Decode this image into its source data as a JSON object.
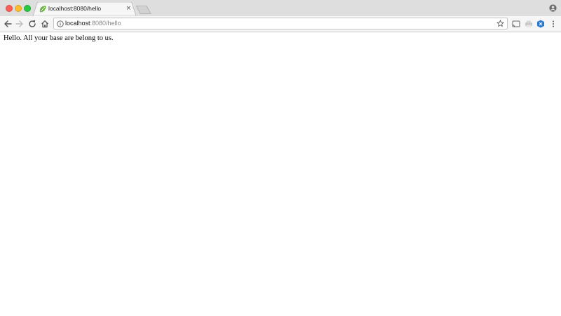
{
  "window": {
    "controls": [
      "close-button",
      "minimize-button",
      "zoom-button"
    ]
  },
  "tab": {
    "title": "localhost:8080/hello",
    "close_glyph": "×",
    "favicon": "spring-leaf-icon"
  },
  "address_bar": {
    "host": "localhost",
    "rest": ":8080/hello"
  },
  "page": {
    "text": "Hello. All your base are belong to us."
  },
  "colors": {
    "chrome_bg": "#dedede",
    "toolbar_bg": "#f6f6f6",
    "favicon": "#6db33f"
  }
}
